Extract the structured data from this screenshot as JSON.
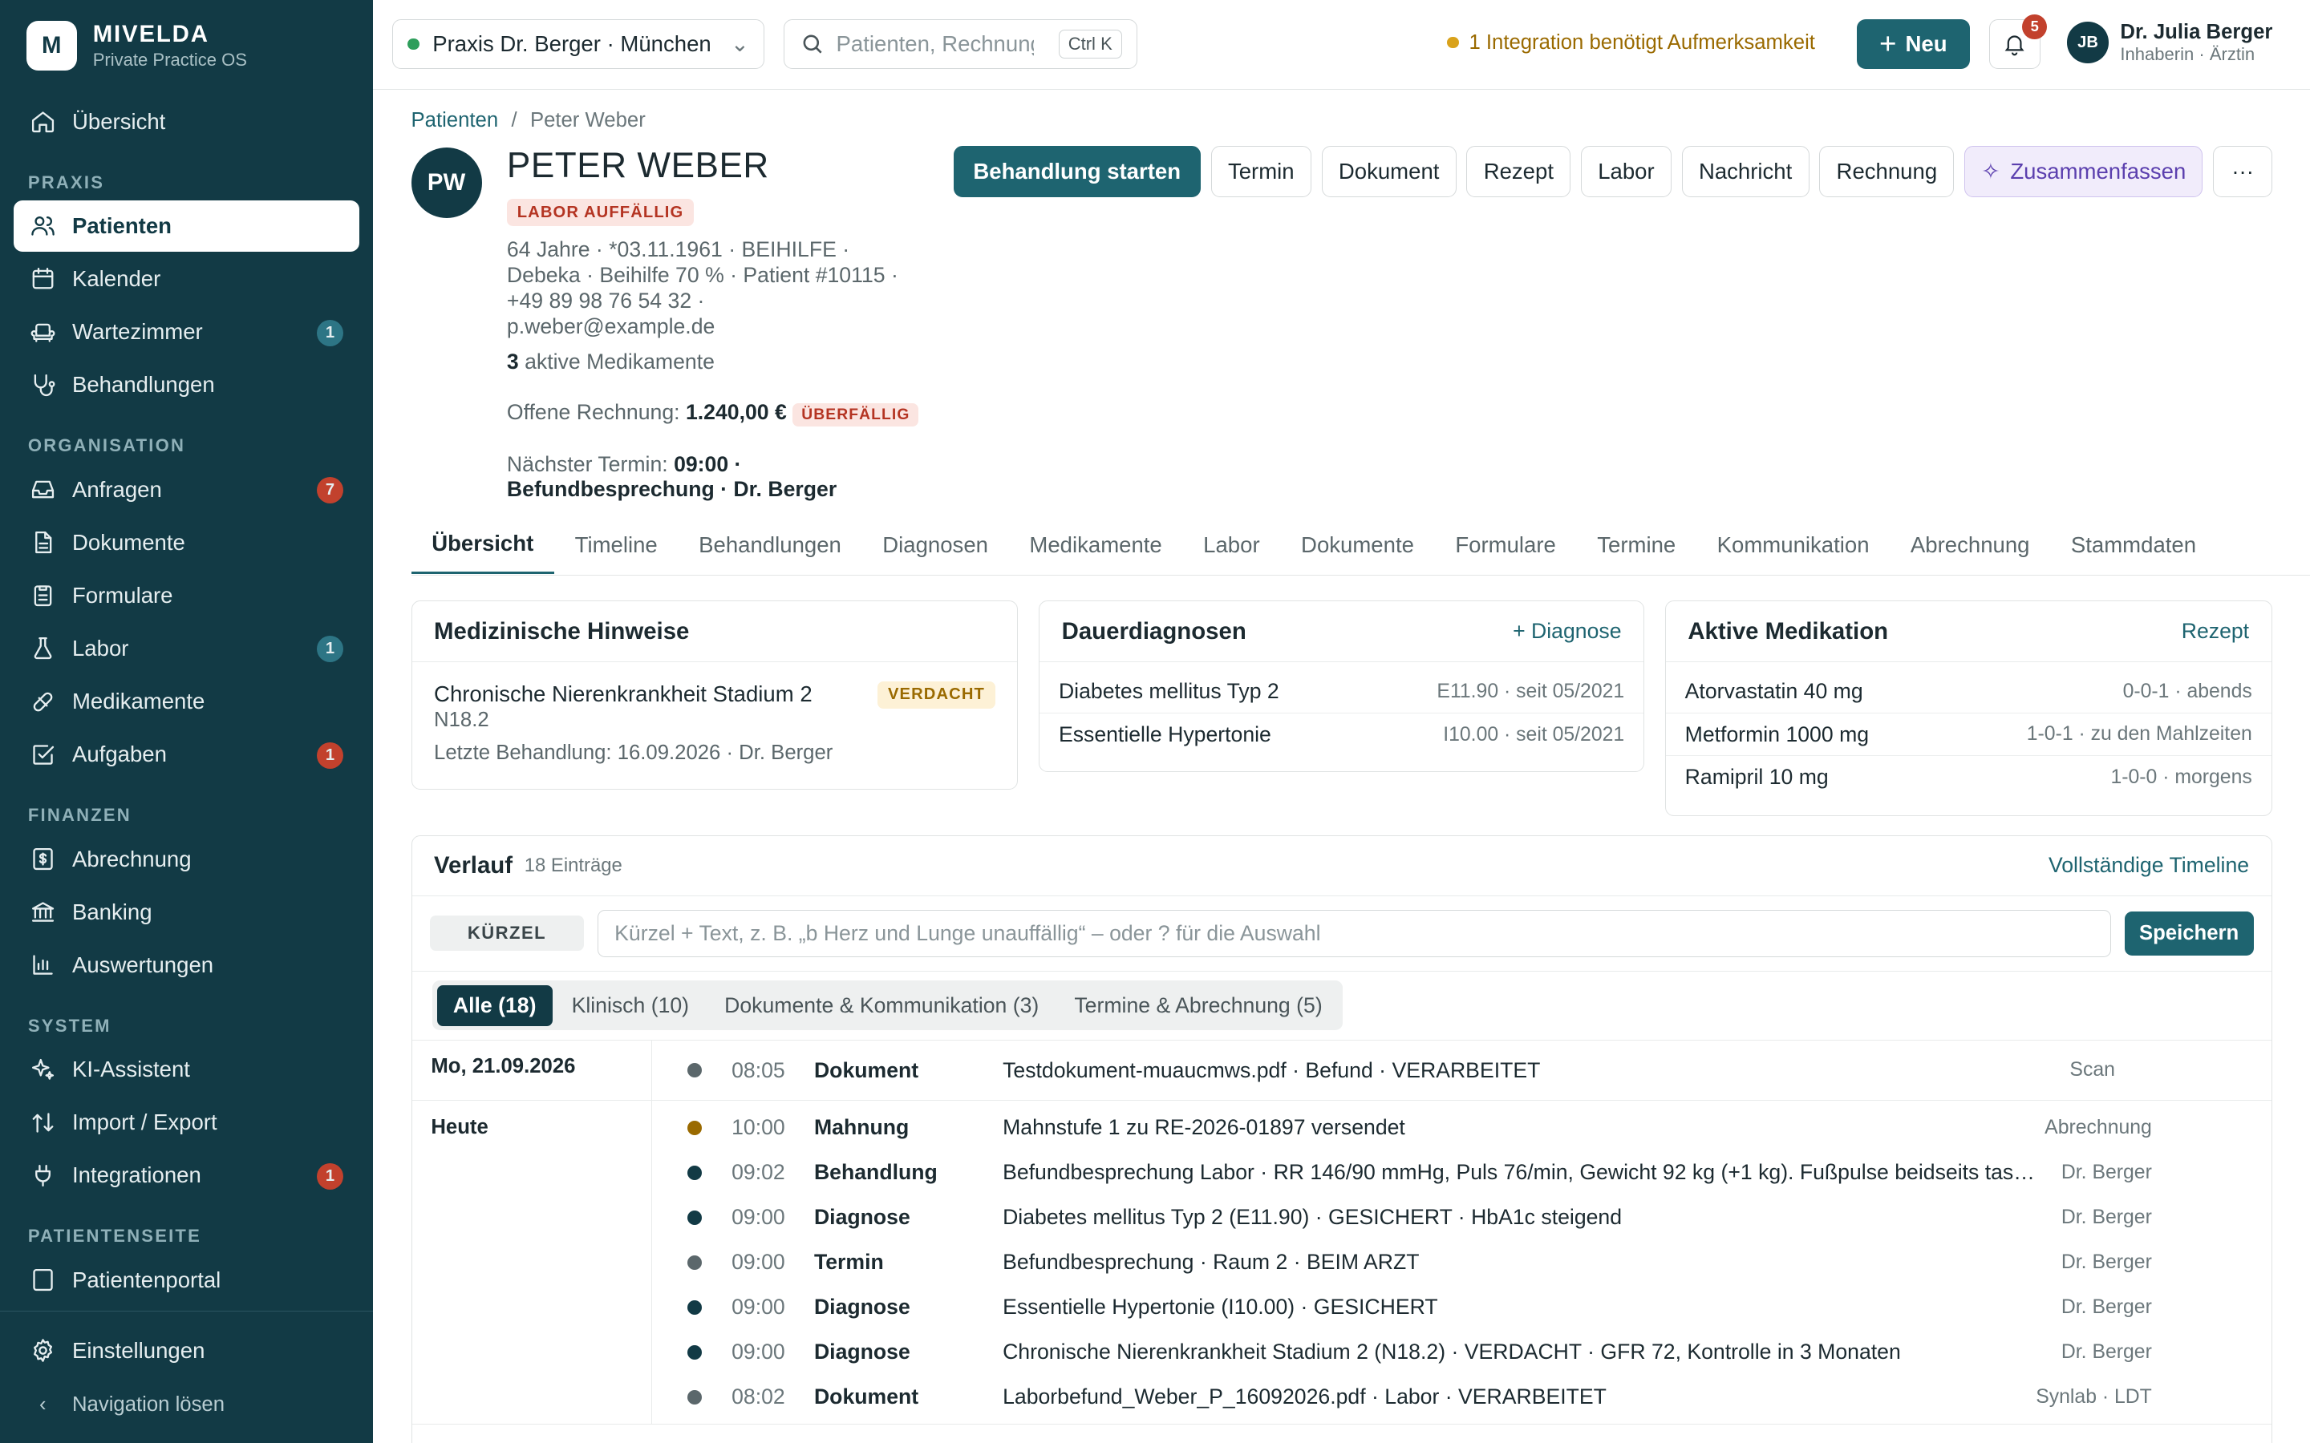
{
  "brand": {
    "logo": "M",
    "name": "MIVELDA",
    "sub": "Private Practice OS"
  },
  "nav": {
    "overview": "Übersicht",
    "sec_praxis": "PRAXIS",
    "patienten": "Patienten",
    "kalender": "Kalender",
    "wartezimmer": "Wartezimmer",
    "wartezimmer_badge": "1",
    "behandlungen": "Behandlungen",
    "sec_org": "ORGANISATION",
    "anfragen": "Anfragen",
    "anfragen_badge": "7",
    "dokumente": "Dokumente",
    "formulare": "Formulare",
    "labor": "Labor",
    "labor_badge": "1",
    "medikamente": "Medikamente",
    "aufgaben": "Aufgaben",
    "aufgaben_badge": "1",
    "sec_fin": "FINANZEN",
    "abrechnung": "Abrechnung",
    "banking": "Banking",
    "auswertungen": "Auswertungen",
    "sec_sys": "SYSTEM",
    "ki": "KI-Assistent",
    "import": "Import / Export",
    "integrationen": "Integrationen",
    "integrationen_badge": "1",
    "sec_pat": "PATIENTENSEITE",
    "portal": "Patientenportal",
    "einstellungen": "Einstellungen",
    "navlose": "Navigation lösen"
  },
  "topbar": {
    "praxis": "Praxis Dr. Berger · München",
    "search_placeholder": "Patienten, Rechnungen…",
    "search_kbd": "Ctrl K",
    "warning": "1 Integration benötigt Aufmerksamkeit",
    "new_label": "Neu",
    "notif_count": "5",
    "user_initials": "JB",
    "user_name": "Dr. Julia Berger",
    "user_role": "Inhaberin · Ärztin"
  },
  "patient": {
    "crumb_root": "Patienten",
    "crumb_sep": "/",
    "crumb_current": "Peter Weber",
    "initials": "PW",
    "name": "PETER WEBER",
    "flag": "LABOR AUFFÄLLIG",
    "meta1": "64 Jahre · *03.11.1961 · BEIHILFE ·",
    "meta2": "Debeka · Beihilfe 70 % · Patient #10115 ·",
    "meta3": "+49 89 98 76 54 32 ·",
    "meta4": "p.weber@example.de",
    "meds_count": "3",
    "meds_label": "aktive Medikamente",
    "invoice_label": "Offene Rechnung:",
    "invoice_amount": "1.240,00 €",
    "invoice_status": "ÜBERFÄLLIG",
    "next_label": "Nächster Termin:",
    "next_time": "09:00 ·",
    "next_desc": "Befundbesprechung · Dr. Berger"
  },
  "actions": {
    "start": "Behandlung starten",
    "termin": "Termin",
    "dokument": "Dokument",
    "rezept": "Rezept",
    "labor": "Labor",
    "nachricht": "Nachricht",
    "rechnung": "Rechnung",
    "ai": "Zusammenfassen",
    "more": "···"
  },
  "tabs": [
    "Übersicht",
    "Timeline",
    "Behandlungen",
    "Diagnosen",
    "Medikamente",
    "Labor",
    "Dokumente",
    "Formulare",
    "Termine",
    "Kommunikation",
    "Abrechnung",
    "Stammdaten"
  ],
  "hinweise": {
    "title": "Medizinische Hinweise",
    "item": "Chronische Nierenkrankheit Stadium 2",
    "code": "N18.2",
    "status": "VERDACHT",
    "last": "Letzte Behandlung: 16.09.2026 · Dr. Berger"
  },
  "diagnosen": {
    "title": "Dauerdiagnosen",
    "link": "+ Diagnose",
    "rows": [
      {
        "name": "Diabetes mellitus Typ 2",
        "meta": "E11.90 · seit 05/2021"
      },
      {
        "name": "Essentielle Hypertonie",
        "meta": "I10.00 · seit 05/2021"
      }
    ]
  },
  "medikation": {
    "title": "Aktive Medikation",
    "link": "Rezept",
    "rows": [
      {
        "name": "Atorvastatin",
        "dose": "40 mg",
        "plan": "0-0-1 · abends"
      },
      {
        "name": "Metformin",
        "dose": "1000 mg",
        "plan": "1-0-1 · zu den Mahlzeiten"
      },
      {
        "name": "Ramipril",
        "dose": "10 mg",
        "plan": "1-0-0 · morgens"
      }
    ]
  },
  "verlauf": {
    "title": "Verlauf",
    "count": "18 Einträge",
    "link": "Vollständige Timeline",
    "kuerzel": "KÜRZEL",
    "placeholder": "Kürzel + Text, z. B. „b Herz und Lunge unauffällig“ – oder ? für die Auswahl",
    "save": "Speichern",
    "filters": [
      "Alle (18)",
      "Klinisch (10)",
      "Dokumente & Kommunikation (3)",
      "Termine & Abrechnung (5)"
    ],
    "days": [
      {
        "label": "Mo, 21.09.2026",
        "events": [
          {
            "time": "08:05",
            "type": "Dokument",
            "text": "Testdokument-muaucmws.pdf · Befund · VERARBEITET",
            "src": "Scan",
            "color": "#5b676b"
          }
        ]
      },
      {
        "label": "Heute",
        "events": [
          {
            "time": "10:00",
            "type": "Mahnung",
            "text": "Mahnstufe 1 zu RE-2026-01897 versendet",
            "src": "Abrechnung",
            "color": "#9a6a00"
          },
          {
            "time": "09:02",
            "type": "Behandlung",
            "text": "Befundbesprechung Labor · RR 146/90 mmHg, Puls 76/min, Gewicht 92 kg (+1 kg). Fußpulse beidseits tastbar",
            "src": "Dr. Berger",
            "color": "#123a45"
          },
          {
            "time": "09:00",
            "type": "Diagnose",
            "text": "Diabetes mellitus Typ 2 (E11.90) · GESICHERT · HbA1c steigend",
            "src": "Dr. Berger",
            "color": "#123a45"
          },
          {
            "time": "09:00",
            "type": "Termin",
            "text": "Befundbesprechung · Raum 2 · BEIM ARZT",
            "src": "Dr. Berger",
            "color": "#5b676b"
          },
          {
            "time": "09:00",
            "type": "Diagnose",
            "text": "Essentielle Hypertonie (I10.00) · GESICHERT",
            "src": "Dr. Berger",
            "color": "#123a45"
          },
          {
            "time": "09:00",
            "type": "Diagnose",
            "text": "Chronische Nierenkrankheit Stadium 2 (N18.2) · VERDACHT · GFR 72, Kontrolle in 3 Monaten",
            "src": "Dr. Berger",
            "color": "#123a45"
          },
          {
            "time": "08:02",
            "type": "Dokument",
            "text": "Laborbefund_Weber_P_16092026.pdf · Labor · VERARBEITET",
            "src": "Synlab · LDT",
            "color": "#5b676b"
          }
        ]
      }
    ]
  },
  "colors": {
    "sidebar": "#123a45",
    "accent": "#1e6470",
    "danger": "#c2412d",
    "warning": "#d9a21b",
    "success": "#2e8b57"
  }
}
